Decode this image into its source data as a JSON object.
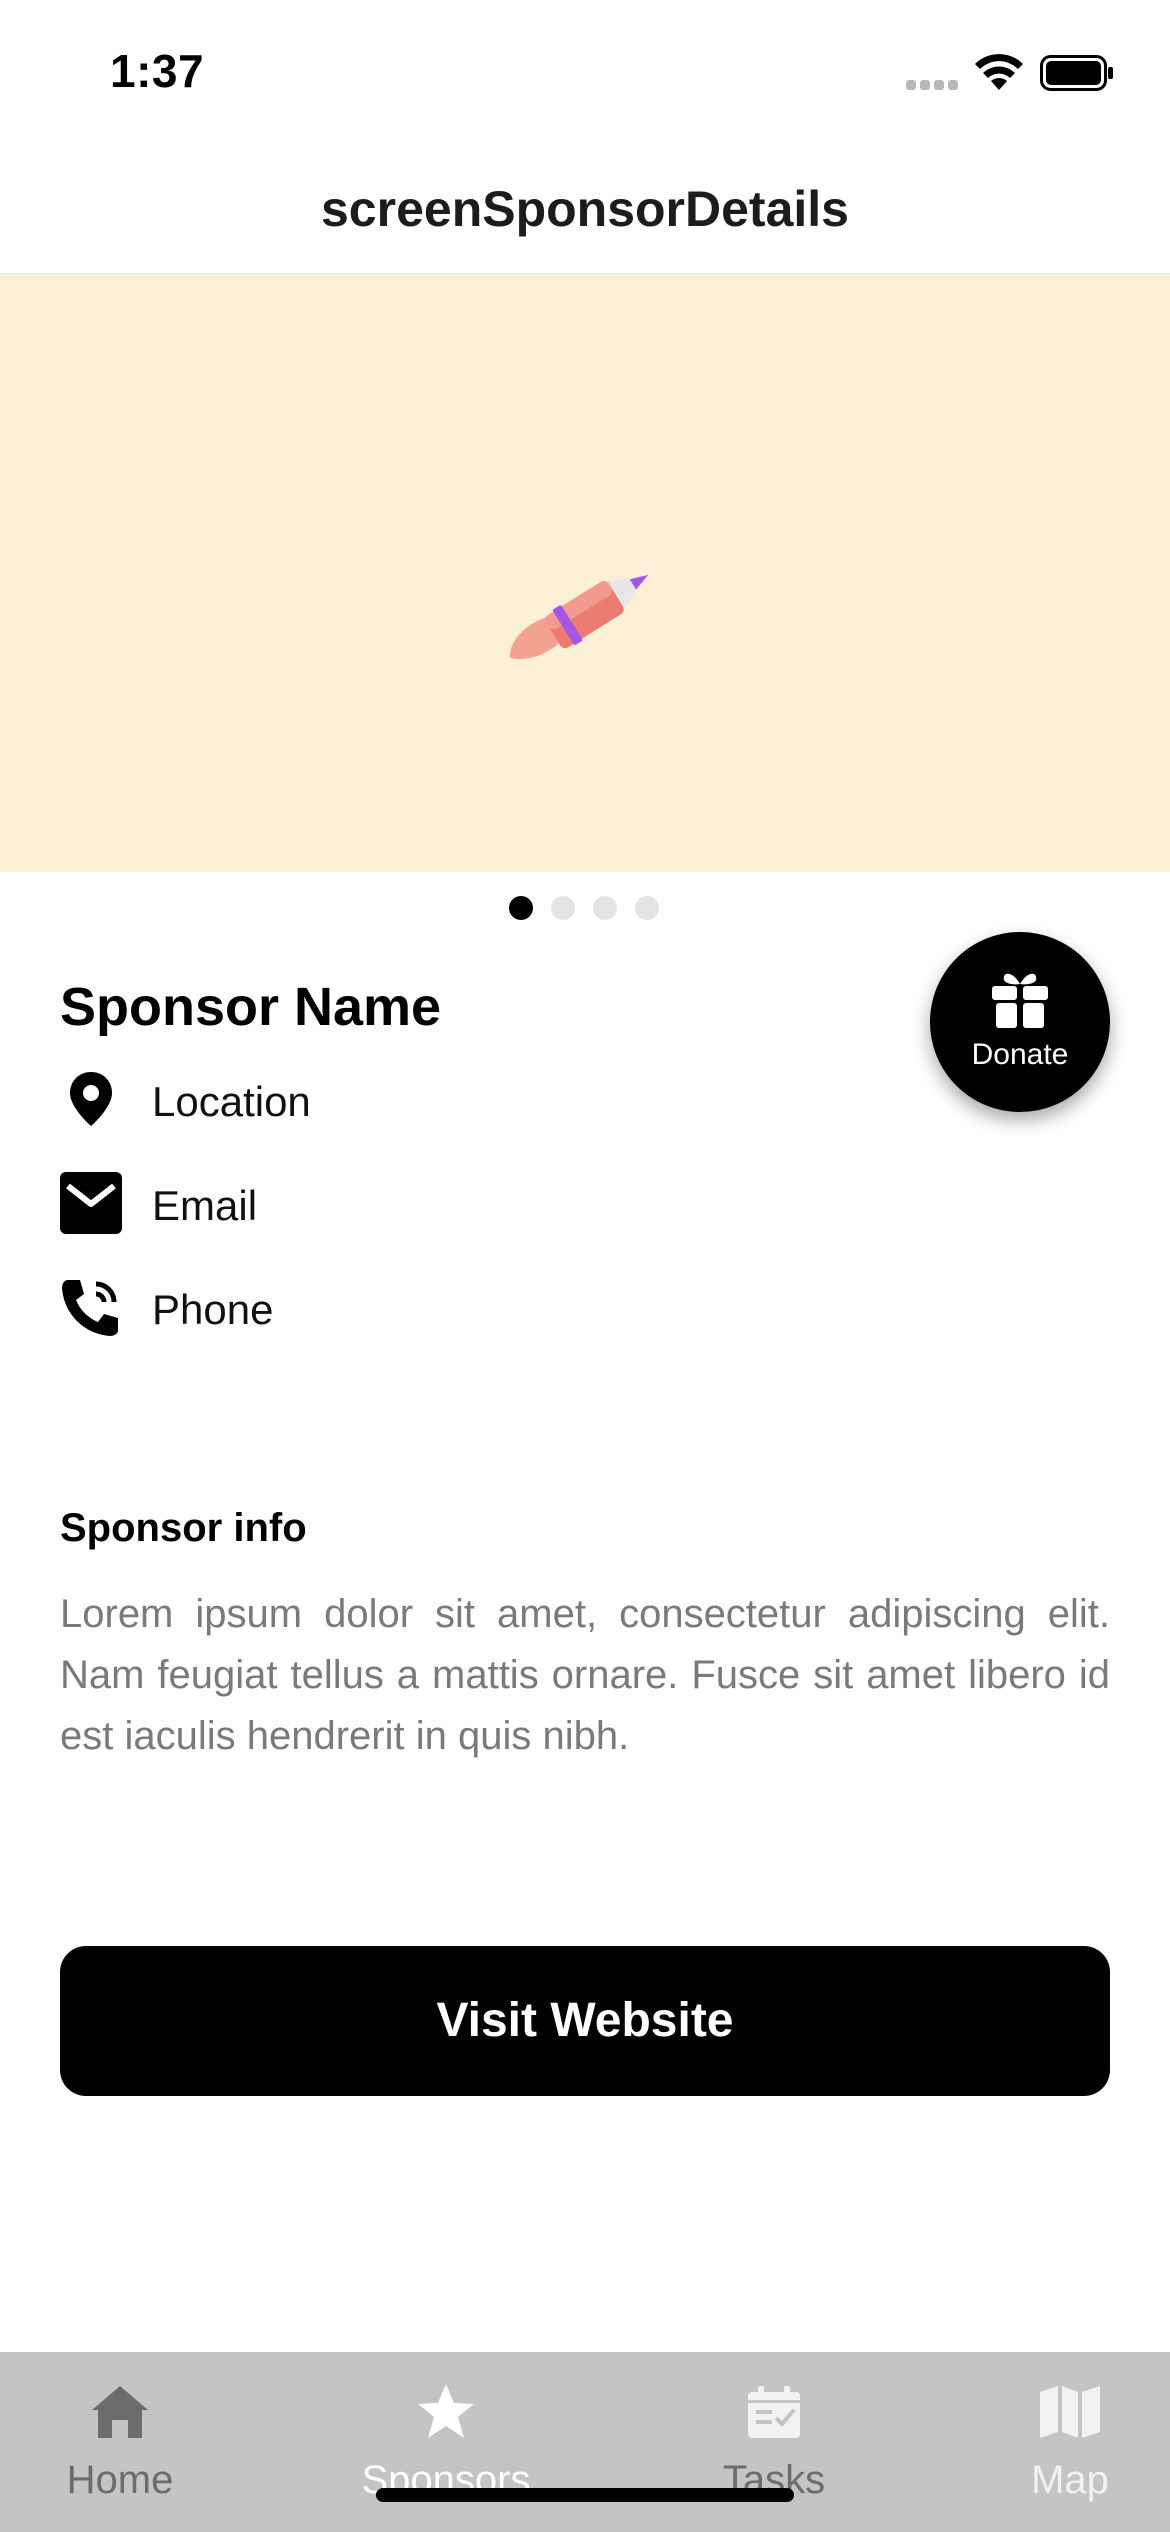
{
  "status_bar": {
    "time": "1:37"
  },
  "nav": {
    "title": "screenSponsorDetails"
  },
  "hero": {
    "image_icon": "rocket-icon",
    "background_color": "#fbefd6",
    "carousel_pages": 4,
    "carousel_active_index": 0
  },
  "sponsor": {
    "name": "Sponsor Name",
    "location_label": "Location",
    "email_label": "Email",
    "phone_label": "Phone"
  },
  "donate": {
    "label": "Donate",
    "icon": "gift-icon"
  },
  "info": {
    "title": "Sponsor info",
    "body": "Lorem ipsum dolor sit amet, consectetur adipiscing elit. Nam feugiat tellus a mattis ornare. Fusce sit amet libero id est iaculis hendrerit in quis nibh."
  },
  "actions": {
    "visit_website_label": "Visit Website"
  },
  "tab_bar": {
    "tabs": [
      {
        "label": "Home",
        "icon": "home-icon",
        "active": false
      },
      {
        "label": "Sponsors",
        "icon": "star-icon",
        "active": true
      },
      {
        "label": "Tasks",
        "icon": "calendar-check-icon",
        "active": false
      },
      {
        "label": "Map",
        "icon": "map-icon",
        "active": false
      }
    ]
  },
  "colors": {
    "primary": "#000000",
    "tab_bar_background": "#c4c4c4",
    "body_text_secondary": "#7a7a7a"
  }
}
